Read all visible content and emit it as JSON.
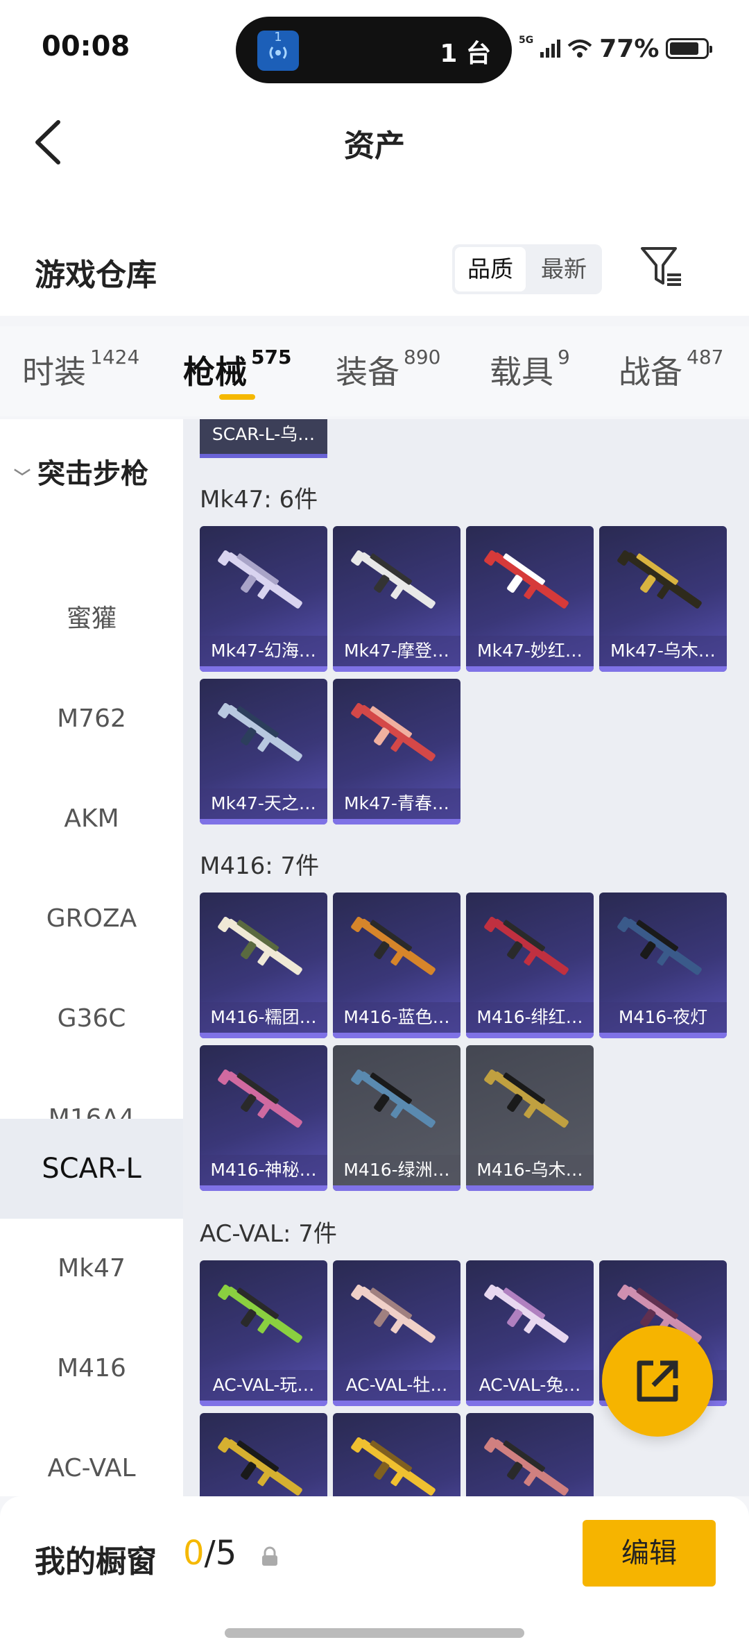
{
  "status_bar": {
    "time": "00:08",
    "island_badge": "1",
    "island_text": "1 台",
    "network": "5G",
    "battery": "77%"
  },
  "header": {
    "title": "资产"
  },
  "warehouse": {
    "title": "游戏仓库",
    "sort_quality": "品质",
    "sort_latest": "最新"
  },
  "tabs": [
    {
      "label": "时装",
      "count": "1424"
    },
    {
      "label": "枪械",
      "count": "575"
    },
    {
      "label": "装备",
      "count": "890"
    },
    {
      "label": "载具",
      "count": "9"
    },
    {
      "label": "战备",
      "count": "487"
    }
  ],
  "sidebar": {
    "category": "突击步枪",
    "items": [
      "蜜獾",
      "M762",
      "AKM",
      "GROZA",
      "G36C",
      "M16A4",
      "SCAR-L",
      "Mk47",
      "M416",
      "AC-VAL"
    ],
    "selected": "SCAR-L"
  },
  "content": {
    "partial_top_label": "SCAR-L-乌…",
    "groups": [
      {
        "title": "Mk47: 6件",
        "items": [
          "Mk47-幻海…",
          "Mk47-摩登…",
          "Mk47-妙红…",
          "Mk47-乌木…",
          "Mk47-天之…",
          "Mk47-青春…"
        ]
      },
      {
        "title": "M416: 7件",
        "items": [
          "M416-糯团…",
          "M416-蓝色…",
          "M416-绯红…",
          "M416-夜灯",
          "M416-神秘…",
          "M416-绿洲…",
          "M416-乌木…"
        ]
      },
      {
        "title": "AC-VAL: 7件",
        "items": [
          "AC-VAL-玩…",
          "AC-VAL-牡…",
          "AC-VAL-兔…",
          "",
          "",
          "",
          ""
        ]
      }
    ]
  },
  "bottom_bar": {
    "label": "我的橱窗",
    "current": "0",
    "total": "/5",
    "edit_label": "编辑"
  }
}
